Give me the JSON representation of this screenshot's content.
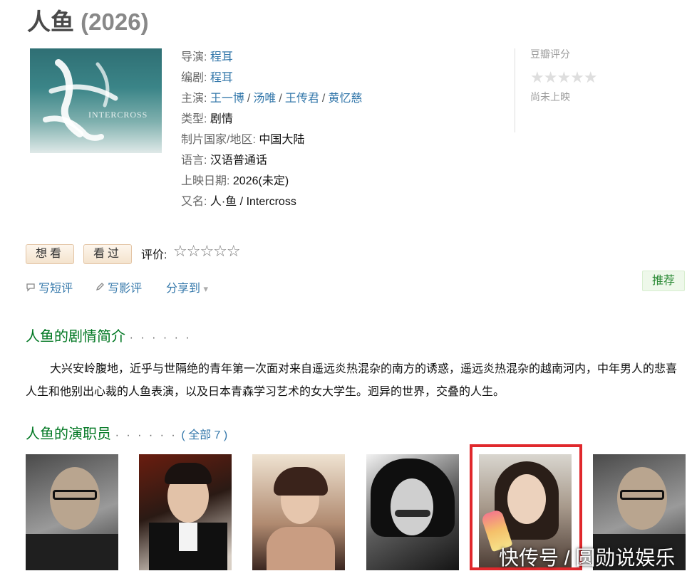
{
  "movie": {
    "title": "人鱼",
    "year": "(2026)"
  },
  "poster": {
    "alt": "人鱼 海报",
    "text_logo": "INTERCROSS"
  },
  "info": {
    "director_label": "导演:",
    "director": "程耳",
    "writer_label": "编剧:",
    "writer": "程耳",
    "cast_label": "主演:",
    "cast": [
      "王一博",
      "汤唯",
      "王传君",
      "黄忆慈"
    ],
    "cast_sep": "/",
    "genre_label": "类型:",
    "genre": "剧情",
    "region_label": "制片国家/地区:",
    "region": "中国大陆",
    "language_label": "语言:",
    "language": "汉语普通话",
    "release_label": "上映日期:",
    "release": "2026(未定)",
    "aka_label": "又名:",
    "aka": "人·鱼 / Intercross"
  },
  "rating": {
    "label": "豆瓣评分",
    "stars": "★★★★★",
    "status": "尚未上映"
  },
  "actions": {
    "want": "想看",
    "seen": "看过",
    "rate_label": "评价:",
    "rate_stars": "☆☆☆☆☆",
    "short_review": "写短评",
    "review": "写影评",
    "share": "分享到",
    "share_caret": "▾",
    "recommend": "推荐",
    "short_review_icon": "speech-bubble-icon",
    "review_icon": "pencil-icon"
  },
  "synopsis": {
    "heading": "人鱼的剧情简介",
    "dots": "· · · · · ·",
    "text": "大兴安岭腹地，近乎与世隔绝的青年第一次面对来自遥远炎热混杂的南方的诱惑，遥远炎热混杂的越南河内，中年男人的悲喜人生和他别出心裁的人鱼表演，以及日本青森学习艺术的女大学生。迥异的世界，交叠的人生。"
  },
  "cast_section": {
    "heading": "人鱼的演职员",
    "dots": "· · · · · ·",
    "all_link": "( 全部 7 )"
  },
  "watermark": "快传号 / 圆勋说娱乐",
  "colors": {
    "link": "#3377aa",
    "section": "#007722",
    "highlight": "#e0282c"
  }
}
